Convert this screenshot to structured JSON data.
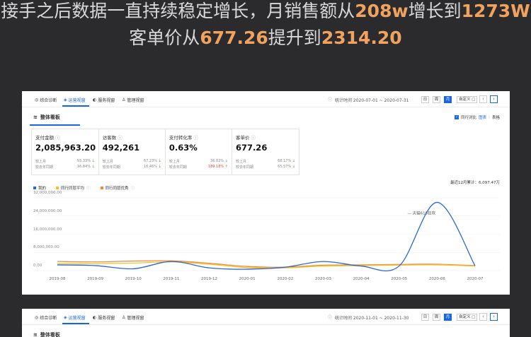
{
  "headline": {
    "line1_pre": "接手之后数据一直持续稳定增长，月销售额从",
    "line1_a": "208w",
    "line1_mid": "增长到",
    "line1_b": "1273W",
    "line2_pre": "客单价从",
    "line2_a": "677.26",
    "line2_mid": "提升到",
    "line2_b": "2314.20"
  },
  "panel1": {
    "tabs": [
      "综合诊断",
      "运营视窗",
      "服务视窗",
      "管理视窗"
    ],
    "active_tab": 1,
    "stat_range": "统计时间 2020-07-01 ~ 2020-07-31",
    "periods": [
      "日",
      "周",
      "月"
    ],
    "active_period": 2,
    "custom": "自定义",
    "section_title": "整体看板",
    "opt_compare": "同行对比",
    "opt_chart": "图表",
    "opt_table": "表格",
    "kpis": [
      {
        "label": "支付金额",
        "value": "2,085,963.20",
        "mom_label": "较上月",
        "mom": "93.33%",
        "mom_dir": "down",
        "yoy_label": "较去年同期",
        "yoy": "16.84%",
        "yoy_dir": "down"
      },
      {
        "label": "访客数",
        "value": "492,261",
        "mom_label": "较上月",
        "mom": "67.23%",
        "mom_dir": "down",
        "yoy_label": "较去年同期",
        "yoy": "16.46%",
        "yoy_dir": "down"
      },
      {
        "label": "支付转化率",
        "value": "0.63%",
        "mom_label": "较上月",
        "mom": "36.02%",
        "mom_dir": "down",
        "yoy_label": "较去年同期",
        "yoy": "189.18%",
        "yoy_dir": "up"
      },
      {
        "label": "客单价",
        "value": "677.26",
        "mom_label": "较上月",
        "mom": "68.17%",
        "mom_dir": "down",
        "yoy_label": "较去年同期",
        "yoy": "65.57%",
        "yoy_dir": "down"
      }
    ],
    "legend": [
      "我的",
      "同行同层平均",
      "同行同层优秀"
    ],
    "total": "最近12月累计：6,097.47万",
    "annotation": "— 天猫618狂欢"
  },
  "panel2": {
    "tabs": [
      "综合诊断",
      "运营视窗",
      "服务视窗",
      "管理视窗"
    ],
    "active_tab": 1,
    "stat_range": "统计时间 2020-11-01 ~ 2020-11-30",
    "periods": [
      "日",
      "周",
      "月"
    ],
    "active_period": 2,
    "custom": "自定义",
    "section_title": "整体看板"
  },
  "colors": {
    "accent": "#1a66e0",
    "mine": "#2a67d6",
    "avg": "#f2c230",
    "excellent": "#ef8a3a",
    "highlight": "#f0a35e"
  },
  "chart_data": {
    "type": "line",
    "categories": [
      "2019-08",
      "2019-09",
      "2019-10",
      "2019-11",
      "2019-12",
      "2020-01",
      "2020-02",
      "2020-03",
      "2020-04",
      "2020-05",
      "2020-06",
      "2020-07"
    ],
    "y_tick_labels": [
      "32,000,000.00",
      "24,000,000.00",
      "16,000,000.00",
      "8,000,000.00",
      "0.00"
    ],
    "ylim": [
      0,
      32000000
    ],
    "series": [
      {
        "name": "我的",
        "values": [
          2500000,
          2200000,
          800000,
          4000000,
          1200000,
          600000,
          1500000,
          4000000,
          2000000,
          2000000,
          30000000,
          2085963
        ]
      },
      {
        "name": "同行同层平均",
        "values": [
          3000000,
          3000000,
          3300000,
          3800000,
          2800000,
          1300000,
          1200000,
          2000000,
          2200000,
          2400000,
          2500000,
          2000000
        ]
      },
      {
        "name": "同行同层优秀",
        "values": [
          4000000,
          3800000,
          4200000,
          4300000,
          3200000,
          1800000,
          1500000,
          2400000,
          2500000,
          2700000,
          2800000,
          2200000
        ]
      }
    ],
    "grid": true,
    "legend_position": "top-left"
  }
}
